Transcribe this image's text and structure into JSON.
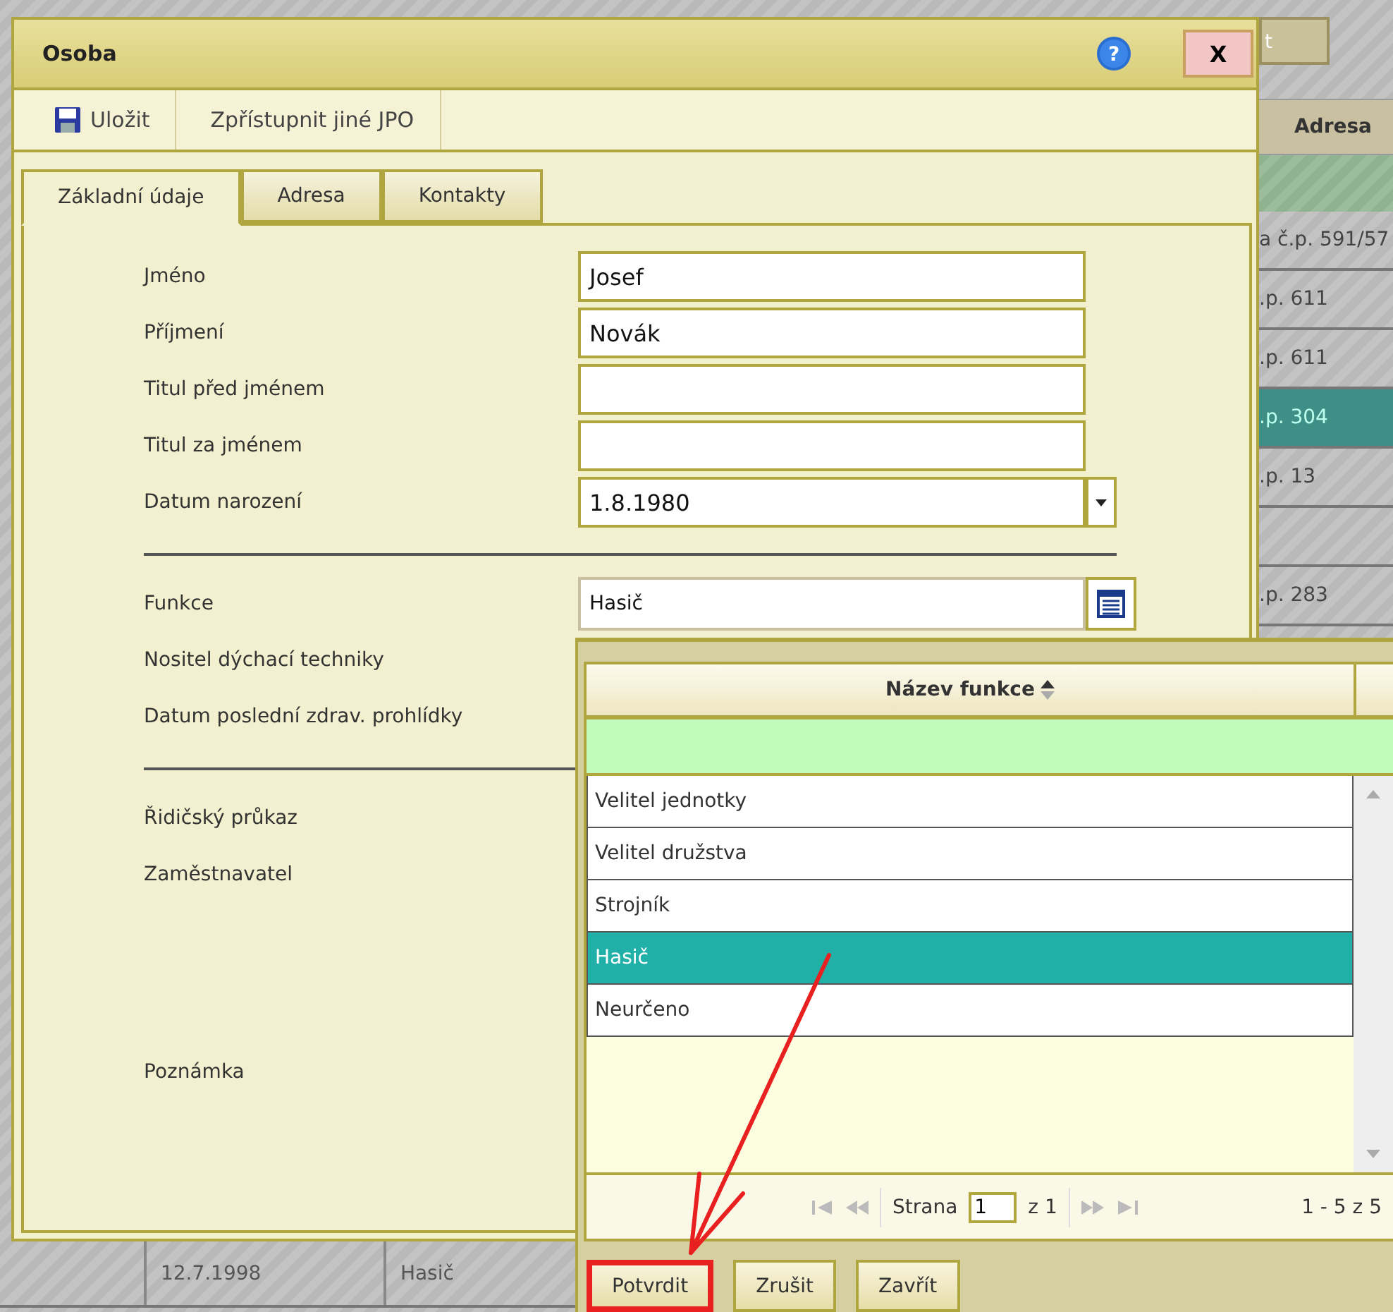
{
  "background": {
    "top_button": "t",
    "column_header": "Adresa",
    "rows": [
      {
        "text": "a č.p. 591/57",
        "selected": false
      },
      {
        "text": ".p. 611",
        "selected": false
      },
      {
        "text": ".p. 611",
        "selected": false
      },
      {
        "text": ".p. 304",
        "selected": true
      },
      {
        "text": ".p. 13",
        "selected": false
      },
      {
        "selected": false
      },
      {
        "text": ".p. 283",
        "selected": false
      }
    ],
    "bottom_row": [
      "12.7.1998",
      "Hasič"
    ]
  },
  "dialog": {
    "title": "Osoba",
    "help": "?",
    "close": "X",
    "toolbar": [
      {
        "kind": "save",
        "label": "Uložit"
      },
      {
        "kind": "plain",
        "label": "Zpřístupnit jiné JPO"
      }
    ],
    "tabs": [
      {
        "label": "Základní údaje",
        "selected": true
      },
      {
        "label": "Adresa",
        "selected": false
      },
      {
        "label": "Kontakty",
        "selected": false
      }
    ],
    "form": [
      {
        "kind": "text",
        "label": "Jméno",
        "value": "Josef"
      },
      {
        "kind": "text",
        "label": "Příjmení",
        "value": "Novák"
      },
      {
        "kind": "text",
        "label": "Titul před jménem"
      },
      {
        "kind": "text",
        "label": "Titul za jménem"
      },
      {
        "kind": "date",
        "label": "Datum narození",
        "value": "1.8.1980"
      },
      {
        "kind": "separator"
      },
      {
        "kind": "lookup",
        "label": "Funkce",
        "value": "Hasič"
      },
      {
        "kind": "label",
        "label": "Nositel dýchací techniky"
      },
      {
        "kind": "label",
        "label": "Datum poslední zdrav. prohlídky"
      },
      {
        "kind": "separator"
      },
      {
        "kind": "label",
        "label": "Řidičský průkaz"
      },
      {
        "kind": "label",
        "label": "Zaměstnavatel"
      },
      {
        "kind": "note",
        "label": "Poznámka"
      }
    ]
  },
  "popup": {
    "column": "Název funkce",
    "rows": [
      {
        "text": "Velitel jednotky",
        "selected": false
      },
      {
        "text": "Velitel družstva",
        "selected": false
      },
      {
        "text": "Strojník",
        "selected": false
      },
      {
        "text": "Hasič",
        "selected": true
      },
      {
        "text": "Neurčeno",
        "selected": false
      }
    ],
    "pager": {
      "page_label": "Strana",
      "page": "1",
      "page_count": "z 1",
      "summary": "1 - 5 z 5"
    },
    "buttons": [
      {
        "label": "Potvrdit",
        "highlighted": true
      },
      {
        "label": "Zrušit",
        "highlighted": false
      },
      {
        "label": "Zavřít",
        "highlighted": false
      }
    ]
  }
}
